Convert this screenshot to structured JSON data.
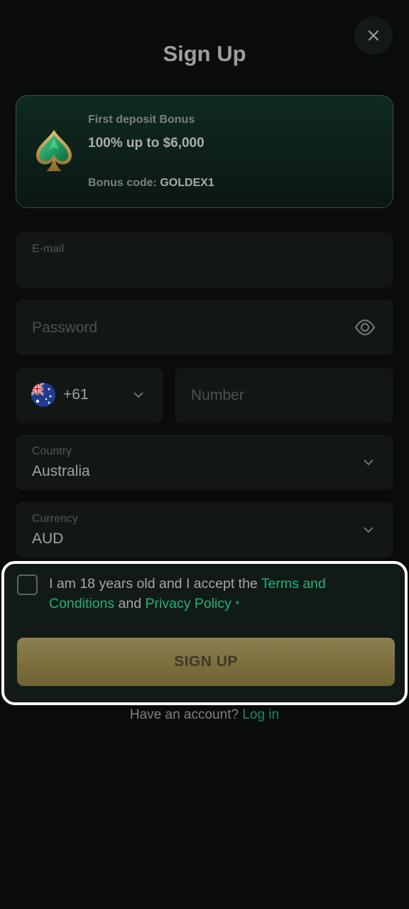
{
  "header": {
    "title": "Sign Up",
    "close_icon": "close-icon"
  },
  "bonus": {
    "label": "First deposit Bonus",
    "amount": "100% up to $6,000",
    "code_label": "Bonus code:",
    "code_value": "GOLDEX1",
    "icon": "spade-icon"
  },
  "form": {
    "email_label": "E-mail",
    "email_value": "",
    "password_placeholder": "Password",
    "password_icon": "eye-icon",
    "phone_code": "+61",
    "phone_flag": "australia-flag-icon",
    "phone_placeholder": "Number",
    "country_label": "Country",
    "country_value": "Australia",
    "currency_label": "Currency",
    "currency_value": "AUD"
  },
  "consent": {
    "text_before": "I am 18 years old and I accept the ",
    "terms_link": "Terms and Conditions",
    "text_between": " and ",
    "privacy_link": "Privacy Policy",
    "required_mark": "*",
    "checked": false
  },
  "actions": {
    "signup_label": "SIGN UP",
    "have_account_text": "Have an account?",
    "login_link": "Log in"
  },
  "colors": {
    "accent_green": "#20b37a",
    "gold_button": "#8b8150",
    "background": "#090c0b"
  }
}
